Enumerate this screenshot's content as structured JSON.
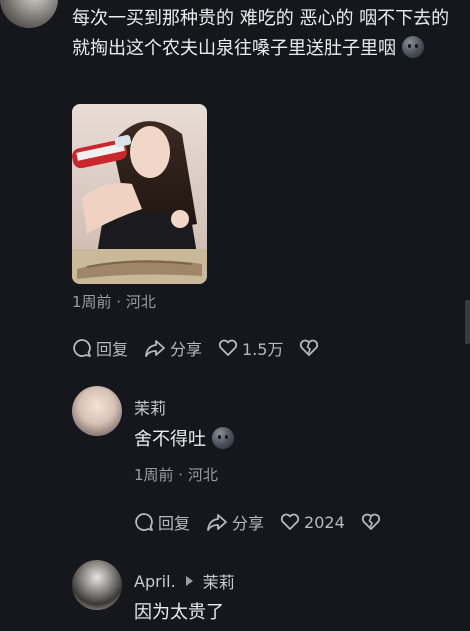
{
  "comment1": {
    "text": "每次一买到那种贵的 难吃的 恶心的 咽不下去的就掏出这个农夫山泉往嗓子里送肚子里咽",
    "time_location": "1周前 · 河北",
    "reply_label": "回复",
    "share_label": "分享",
    "likes": "1.5万"
  },
  "reply1": {
    "username": "茉莉",
    "text": "舍不得吐",
    "time_location": "1周前 · 河北",
    "reply_label": "回复",
    "share_label": "分享",
    "likes": "2024"
  },
  "reply2": {
    "username": "April.",
    "reply_to": "茉莉",
    "text": "因为太贵了"
  },
  "colors": {
    "background": "#16171d",
    "text": "#ececee",
    "meta": "#9a9ba3"
  }
}
